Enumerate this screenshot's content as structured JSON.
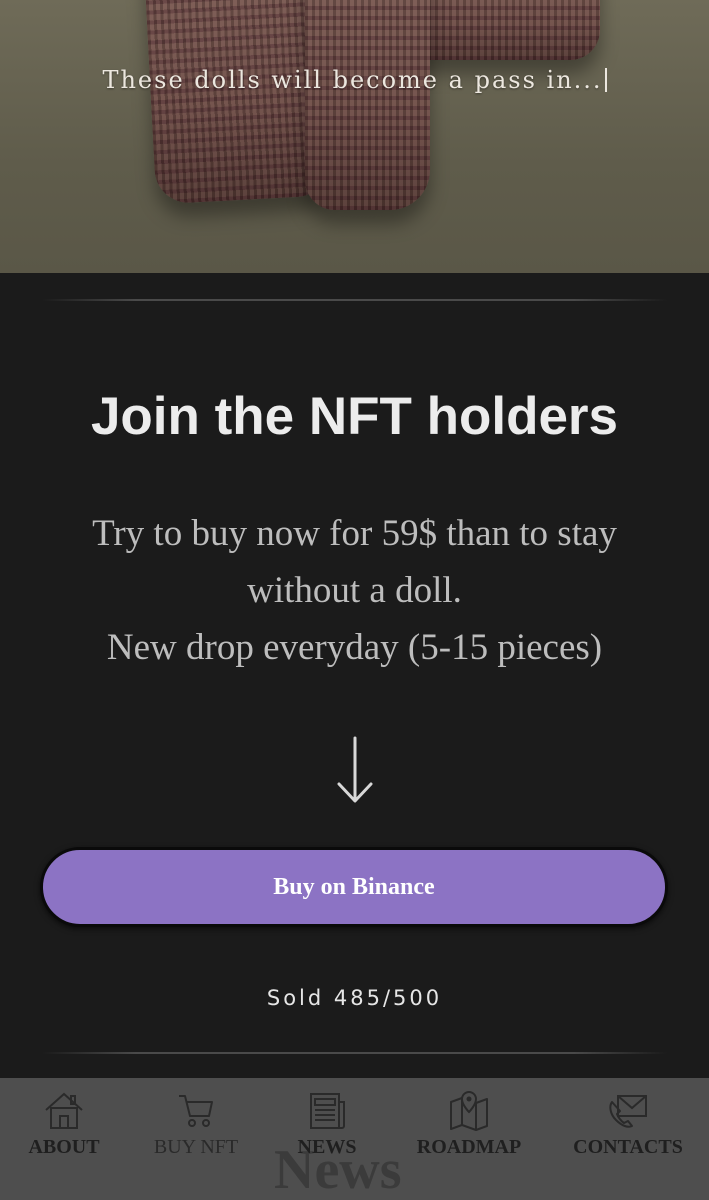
{
  "hero": {
    "caption": "These dolls will become a pass in..."
  },
  "cta": {
    "title": "Join the NFT holders",
    "description_lines": [
      "Try to buy now for 59$ than to stay",
      "without a doll.",
      "New drop everyday (5-15 pieces)"
    ],
    "arrow_icon": "arrow-down-icon",
    "button_label": "Buy on Binance",
    "button_color": "#8c73c4",
    "sold_text": "Sold 485/500"
  },
  "bottom_nav": {
    "background_word": "News",
    "items": [
      {
        "label": "ABOUT",
        "icon": "home-icon"
      },
      {
        "label": "BUY NFT",
        "icon": "cart-icon"
      },
      {
        "label": "NEWS",
        "icon": "newspaper-icon"
      },
      {
        "label": "ROADMAP",
        "icon": "map-pin-icon"
      },
      {
        "label": "CONTACTS",
        "icon": "envelope-icon"
      }
    ]
  },
  "colors": {
    "page_background": "#1b1b1b",
    "nav_background": "#4e4e4e",
    "title_color": "#ececec"
  }
}
